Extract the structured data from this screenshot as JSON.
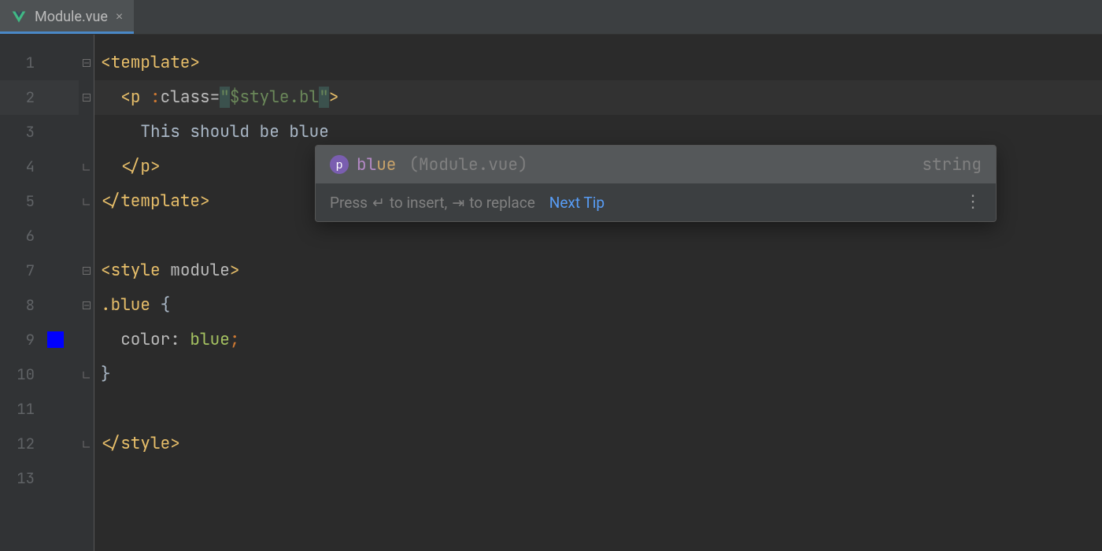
{
  "tab": {
    "filename": "Module.vue",
    "close_glyph": "×"
  },
  "gutter": {
    "lines": [
      "1",
      "2",
      "3",
      "4",
      "5",
      "6",
      "7",
      "8",
      "9",
      "10",
      "11",
      "12",
      "13"
    ],
    "current_line_index": 1,
    "color_swatch_line_index": 8,
    "color_swatch_hex": "#0000ff"
  },
  "code": {
    "l1": {
      "open": "<",
      "tag": "template",
      "close": ">"
    },
    "l2": {
      "indent": "  ",
      "open": "<",
      "tag": "p",
      "sp": " ",
      "bindpfx": ":",
      "attr": "class",
      "eq": "=",
      "q": "\"",
      "expr": "$style.bl",
      "q2": "\"",
      "close": ">"
    },
    "l3": {
      "indent": "    ",
      "text": "This should be blue"
    },
    "l4": {
      "indent": "  ",
      "open": "</",
      "tag": "p",
      "close": ">"
    },
    "l5": {
      "open": "</",
      "tag": "template",
      "close": ">"
    },
    "l7": {
      "open": "<",
      "tag": "style",
      "sp": " ",
      "attr": "module",
      "close": ">"
    },
    "l8": {
      "sel": ".blue",
      "sp": " ",
      "brace": "{"
    },
    "l9": {
      "indent": "  ",
      "prop": "color",
      "colon": ":",
      "sp": " ",
      "val": "blue",
      "semi": ";"
    },
    "l10": {
      "brace": "}"
    },
    "l12": {
      "open": "</",
      "tag": "style",
      "close": ">"
    }
  },
  "completion": {
    "item": {
      "icon_letter": "p",
      "match_part": "bl",
      "rest_part": "ue",
      "location": "(Module.vue)",
      "type": "string"
    },
    "footer": {
      "press": "Press ",
      "enter_glyph": "↵",
      "insert": " to insert, ",
      "tab_glyph": "⇥",
      "replace": " to replace",
      "next_tip": "Next Tip",
      "dots": "⋮"
    }
  }
}
